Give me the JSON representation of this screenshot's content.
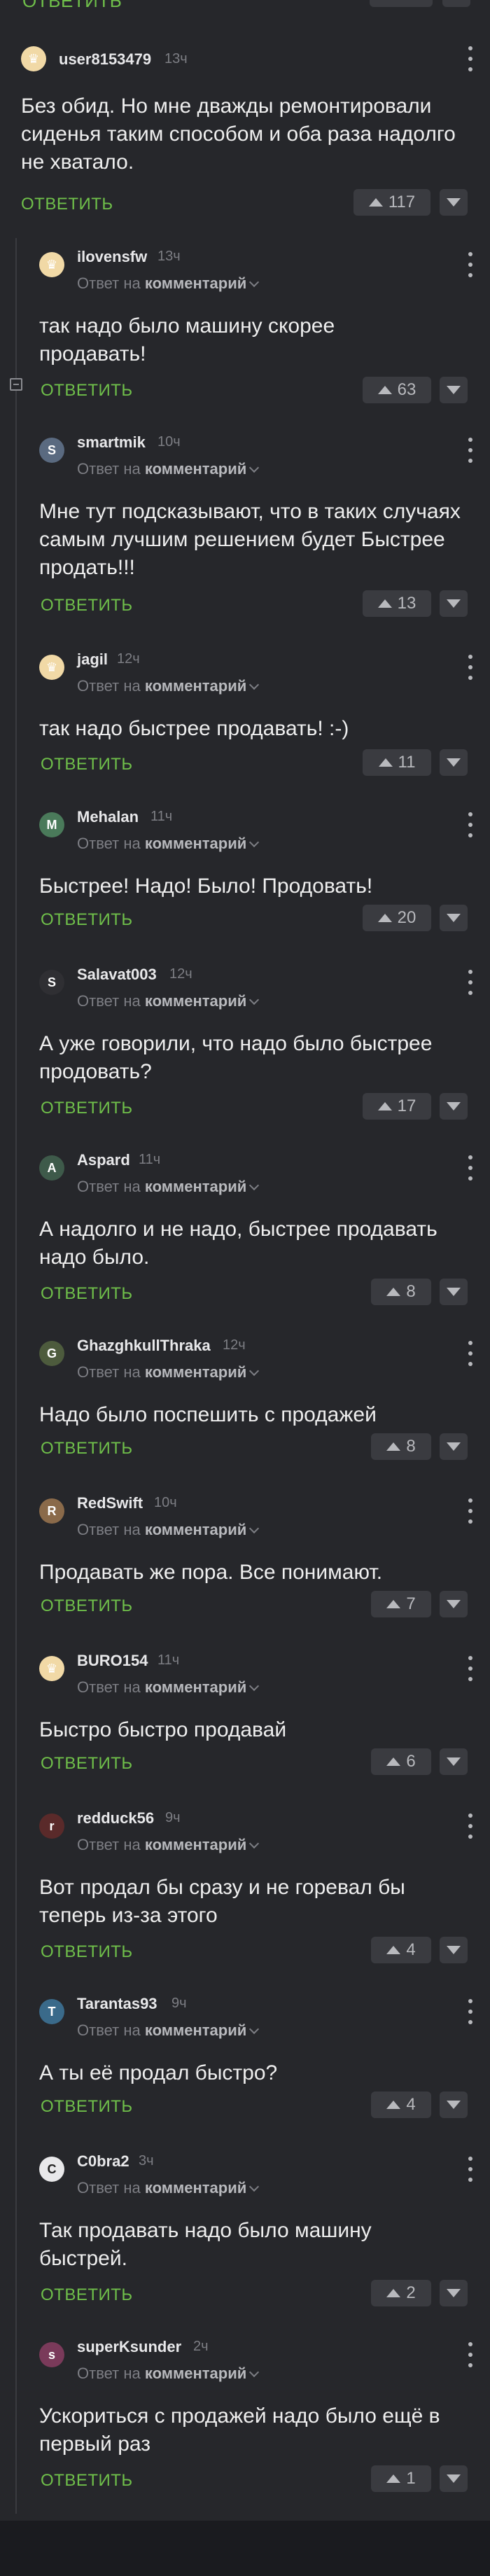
{
  "reply_label": "ОТВЕТИТЬ",
  "reply_to_prefix": "Ответ на",
  "reply_to_target": "комментарий",
  "comments": [
    {
      "username": "user8153479",
      "time": "13ч",
      "text": "Без обид. Но мне дважды ремонтировали сиденья таким способом и оба раза надолго не хватало.",
      "votes": "117",
      "avatar": "crown"
    },
    {
      "username": "ilovensfw",
      "time": "13ч",
      "text": "так надо было машину скорее продавать!",
      "votes": "63",
      "avatar": "crown"
    },
    {
      "username": "smartmik",
      "time": "10ч",
      "text": "Мне тут подсказывают, что в таких случаях самым лучшим решением будет Быстрее продать!!!",
      "votes": "13",
      "avatar": "photo"
    },
    {
      "username": "jagil",
      "time": "12ч",
      "text": "так надо быстрее продавать! :-)",
      "votes": "11",
      "avatar": "crown"
    },
    {
      "username": "Mehalan",
      "time": "11ч",
      "text": "Быстрее! Надо! Было! Продовать!",
      "votes": "20",
      "avatar": "photo"
    },
    {
      "username": "Salavat003",
      "time": "12ч",
      "text": "А уже говорили, что надо было быстрее продовать?",
      "votes": "17",
      "avatar": "photo"
    },
    {
      "username": "Aspard",
      "time": "11ч",
      "text": "А надолго и не надо, быстрее продавать надо было.",
      "votes": "8",
      "avatar": "photo"
    },
    {
      "username": "GhazghkullThraka",
      "time": "12ч",
      "text": "Надо было поспешить с продажей",
      "votes": "8",
      "avatar": "photo"
    },
    {
      "username": "RedSwift",
      "time": "10ч",
      "text": "Продавать же пора. Все понимают.",
      "votes": "7",
      "avatar": "photo"
    },
    {
      "username": "BURO154",
      "time": "11ч",
      "text": "Быстро быстро продавай",
      "votes": "6",
      "avatar": "crown"
    },
    {
      "username": "redduck56",
      "time": "9ч",
      "text": "Вот продал бы сразу и не горевал бы теперь из-за этого",
      "votes": "4",
      "avatar": "photo"
    },
    {
      "username": "Tarantas93",
      "time": "9ч",
      "text": "А ты её продал быстро?",
      "votes": "4",
      "avatar": "photo"
    },
    {
      "username": "C0bra2",
      "time": "3ч",
      "text": "Так продавать надо было машину быстрей.",
      "votes": "2",
      "avatar": "photo"
    },
    {
      "username": "superKsunder",
      "time": "2ч",
      "text": "Ускориться с продажей надо было ещё в первый раз",
      "votes": "1",
      "avatar": "photo"
    }
  ],
  "colors": {
    "accent": "#6fbf4a",
    "background": "#26272b",
    "vote_bg": "#3a3b40"
  }
}
